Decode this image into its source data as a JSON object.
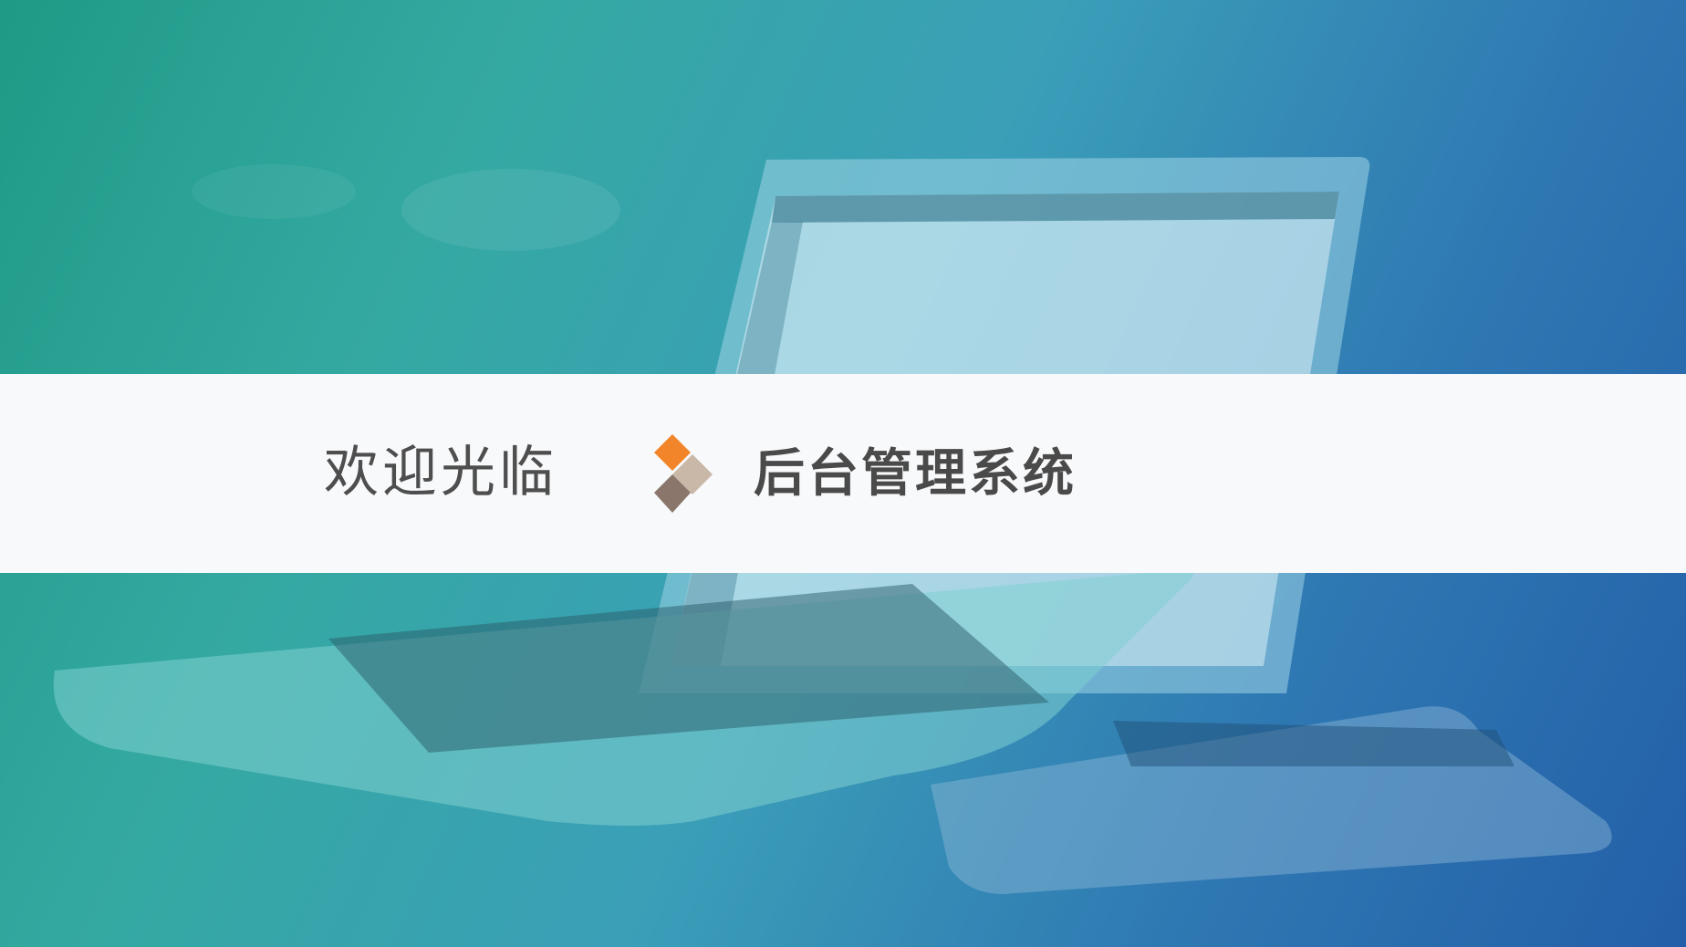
{
  "banner": {
    "welcome_text": "欢迎光临",
    "system_title": "后台管理系统"
  },
  "logo": {
    "icon": "diamond-logo-icon",
    "colors": {
      "top": "#f2852a",
      "right": "#c9b8a8",
      "bottom": "#8a766a"
    }
  },
  "background": {
    "description_icon": "laptop-photo",
    "gradient_colors": [
      "#1f9a86",
      "#34a9a2",
      "#3b9fb8",
      "#2f79b3",
      "#235fa8"
    ]
  }
}
